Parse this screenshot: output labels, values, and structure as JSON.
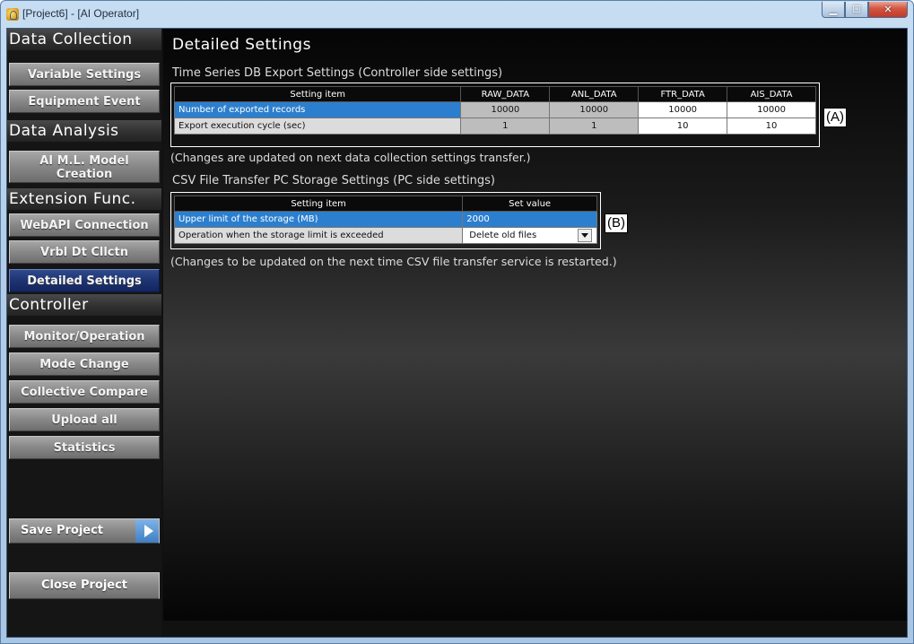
{
  "window": {
    "title": "[Project6] - [AI Operator]"
  },
  "sidebar": {
    "sections": [
      {
        "heading": "Data Collection",
        "items": [
          "Variable Settings",
          "Equipment Event"
        ]
      },
      {
        "heading": "Data Analysis",
        "items": [
          "AI M.L. Model Creation"
        ]
      },
      {
        "heading": "Extension Func.",
        "items": [
          "WebAPI Connection",
          "Vrbl Dt Cllctn",
          "Detailed Settings"
        ]
      },
      {
        "heading": "Controller",
        "items": [
          "Monitor/Operation",
          "Mode Change",
          "Collective Compare",
          "Upload all",
          "Statistics"
        ]
      }
    ],
    "ai_model_line1": "AI M.L. Model",
    "ai_model_line2": "Creation",
    "active_item": "Detailed Settings",
    "save_label": "Save Project",
    "close_label": "Close Project"
  },
  "main": {
    "title": "Detailed Settings",
    "tsdb": {
      "subtitle": "Time Series DB Export Settings (Controller side settings)",
      "headers": [
        "Setting item",
        "RAW_DATA",
        "ANL_DATA",
        "FTR_DATA",
        "AIS_DATA"
      ],
      "rows": [
        {
          "label": "Number of exported records",
          "values": [
            "10000",
            "10000",
            "10000",
            "10000"
          ]
        },
        {
          "label": "Export execution cycle (sec)",
          "values": [
            "1",
            "1",
            "10",
            "10"
          ]
        }
      ],
      "note": "(Changes are updated on next data collection settings transfer.)",
      "callout": "(A)"
    },
    "csv": {
      "subtitle": "CSV File Transfer PC Storage Settings (PC side settings)",
      "headers": [
        "Setting item",
        "Set value"
      ],
      "row1_label": "Upper limit of the storage (MB)",
      "row1_value": "2000",
      "row2_label": "Operation when the storage limit is exceeded",
      "row2_value": "Delete old files",
      "note": "(Changes to be updated on the next time CSV file transfer service is restarted.)",
      "callout": "(B)"
    }
  }
}
